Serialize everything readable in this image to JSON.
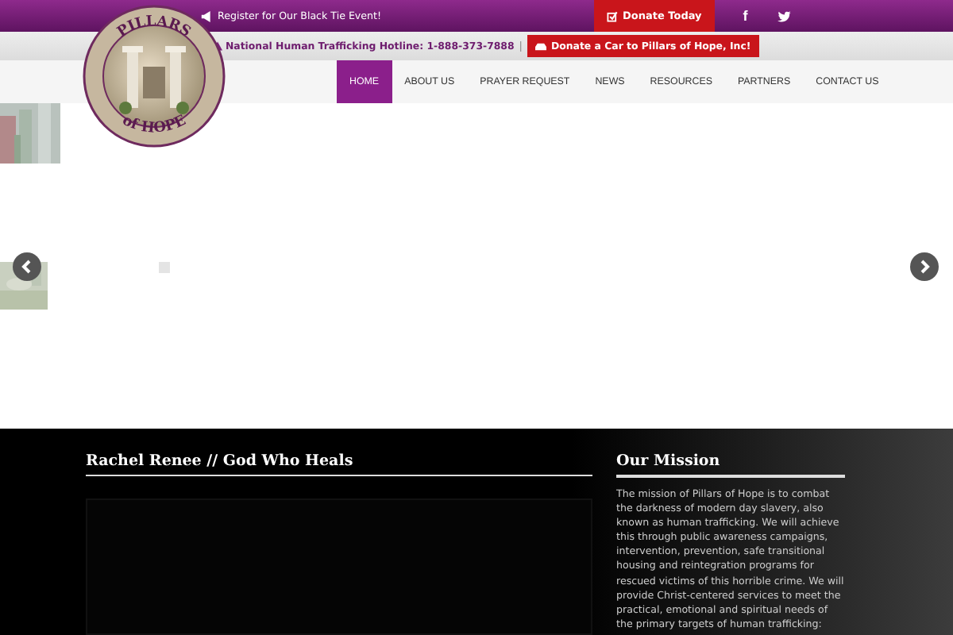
{
  "top_bar": {
    "announcement": "Register for Our Black Tie Event!",
    "donate_button": "Donate Today",
    "social": [
      {
        "kind": "facebook",
        "glyph": "f"
      },
      {
        "kind": "twitter"
      }
    ]
  },
  "hotline_bar": {
    "hotline": "National Human Trafficking Hotline: 1-888-373-7888",
    "separator": "|",
    "car_button": "Donate a Car to Pillars of Hope, Inc!"
  },
  "logo": {
    "top_text": "PILLARS",
    "bottom_text": "of HOPE"
  },
  "nav": [
    {
      "label": "HOME",
      "selected": true
    },
    {
      "label": "ABOUT US",
      "selected": false
    },
    {
      "label": "PRAYER REQUEST",
      "selected": false
    },
    {
      "label": "NEWS",
      "selected": false
    },
    {
      "label": "RESOURCES",
      "selected": false
    },
    {
      "label": "PARTNERS",
      "selected": false
    },
    {
      "label": "CONTACT US",
      "selected": false
    }
  ],
  "video": {
    "title": "Rachel Renee // God Who Heals"
  },
  "mission": {
    "title": "Our Mission",
    "text": "The mission of Pillars of Hope is to combat the darkness of modern day slavery, also known as human trafficking. We will achieve this through public awareness campaigns, intervention, prevention, safe transitional housing and reintegration programs for rescued victims of this horrible crime. We will provide Christ-centered services to meet the practical, emotional and spiritual needs of the primary targets of human trafficking:"
  }
}
